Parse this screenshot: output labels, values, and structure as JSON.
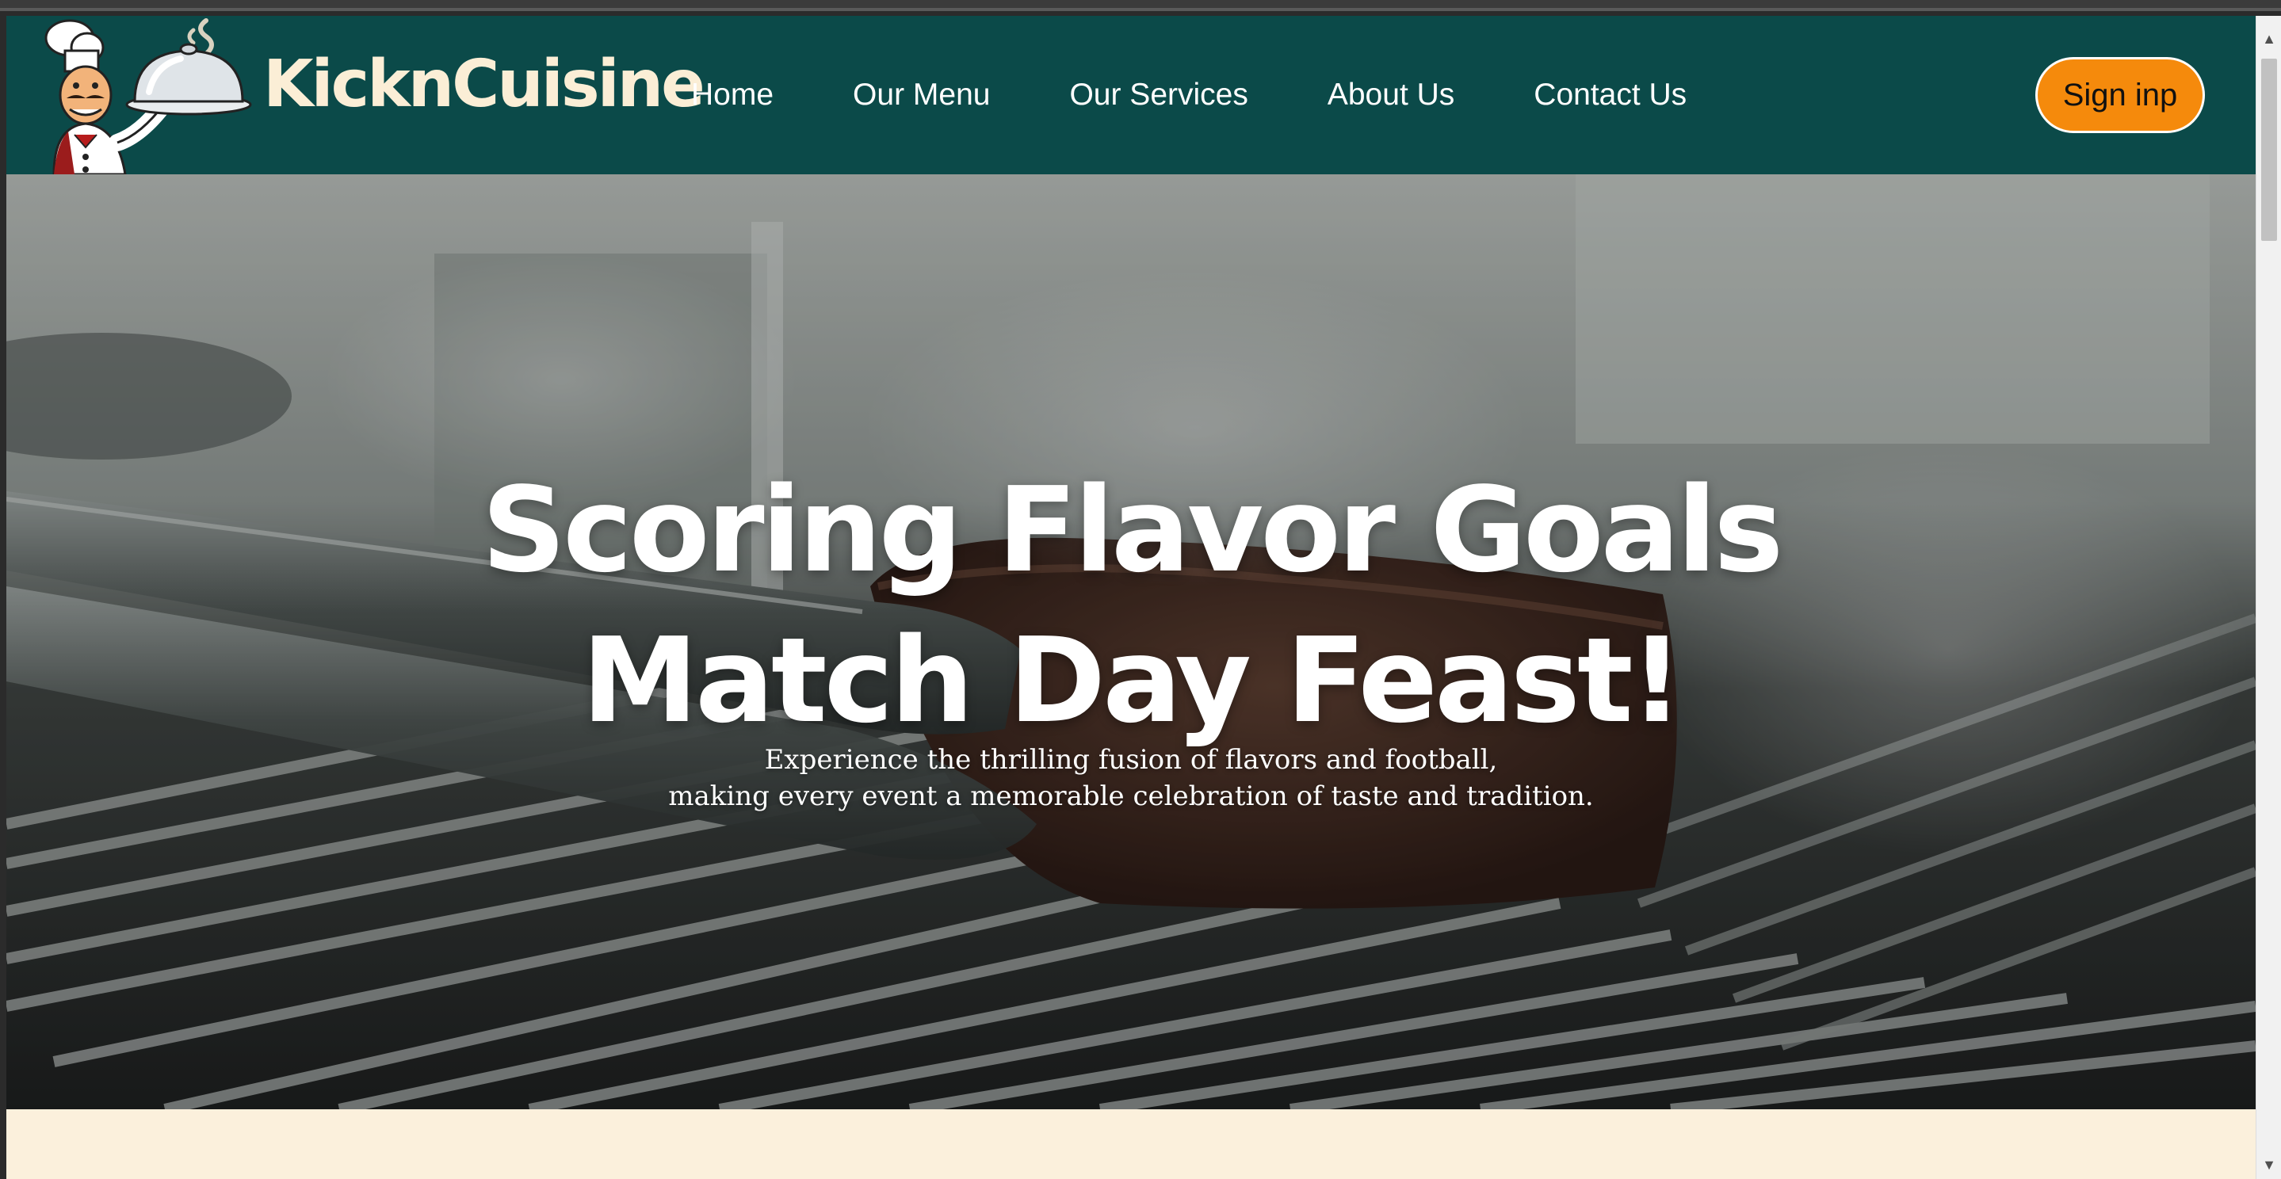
{
  "header": {
    "brand": "KicknCuisine",
    "nav": [
      "Home",
      "Our Menu",
      "Our Services",
      "About Us",
      "Contact Us"
    ],
    "signin_label": "Sign inp"
  },
  "hero": {
    "title_line1": "Scoring Flavor Goals",
    "title_line2": "Match Day Feast!",
    "subtitle_line1": "Experience the thrilling fusion of flavors and football,",
    "subtitle_line2": "making every event a memorable celebration of taste and tradition."
  },
  "colors": {
    "header_bg": "#0b4a49",
    "brand_text": "#fbeed6",
    "signin_bg": "#f58a0c",
    "page_bg": "#fbf0dc"
  },
  "icons": {
    "logo": "chef-holding-cloche-icon",
    "scroll_up": "chevron-up-icon",
    "scroll_down": "chevron-down-icon"
  }
}
